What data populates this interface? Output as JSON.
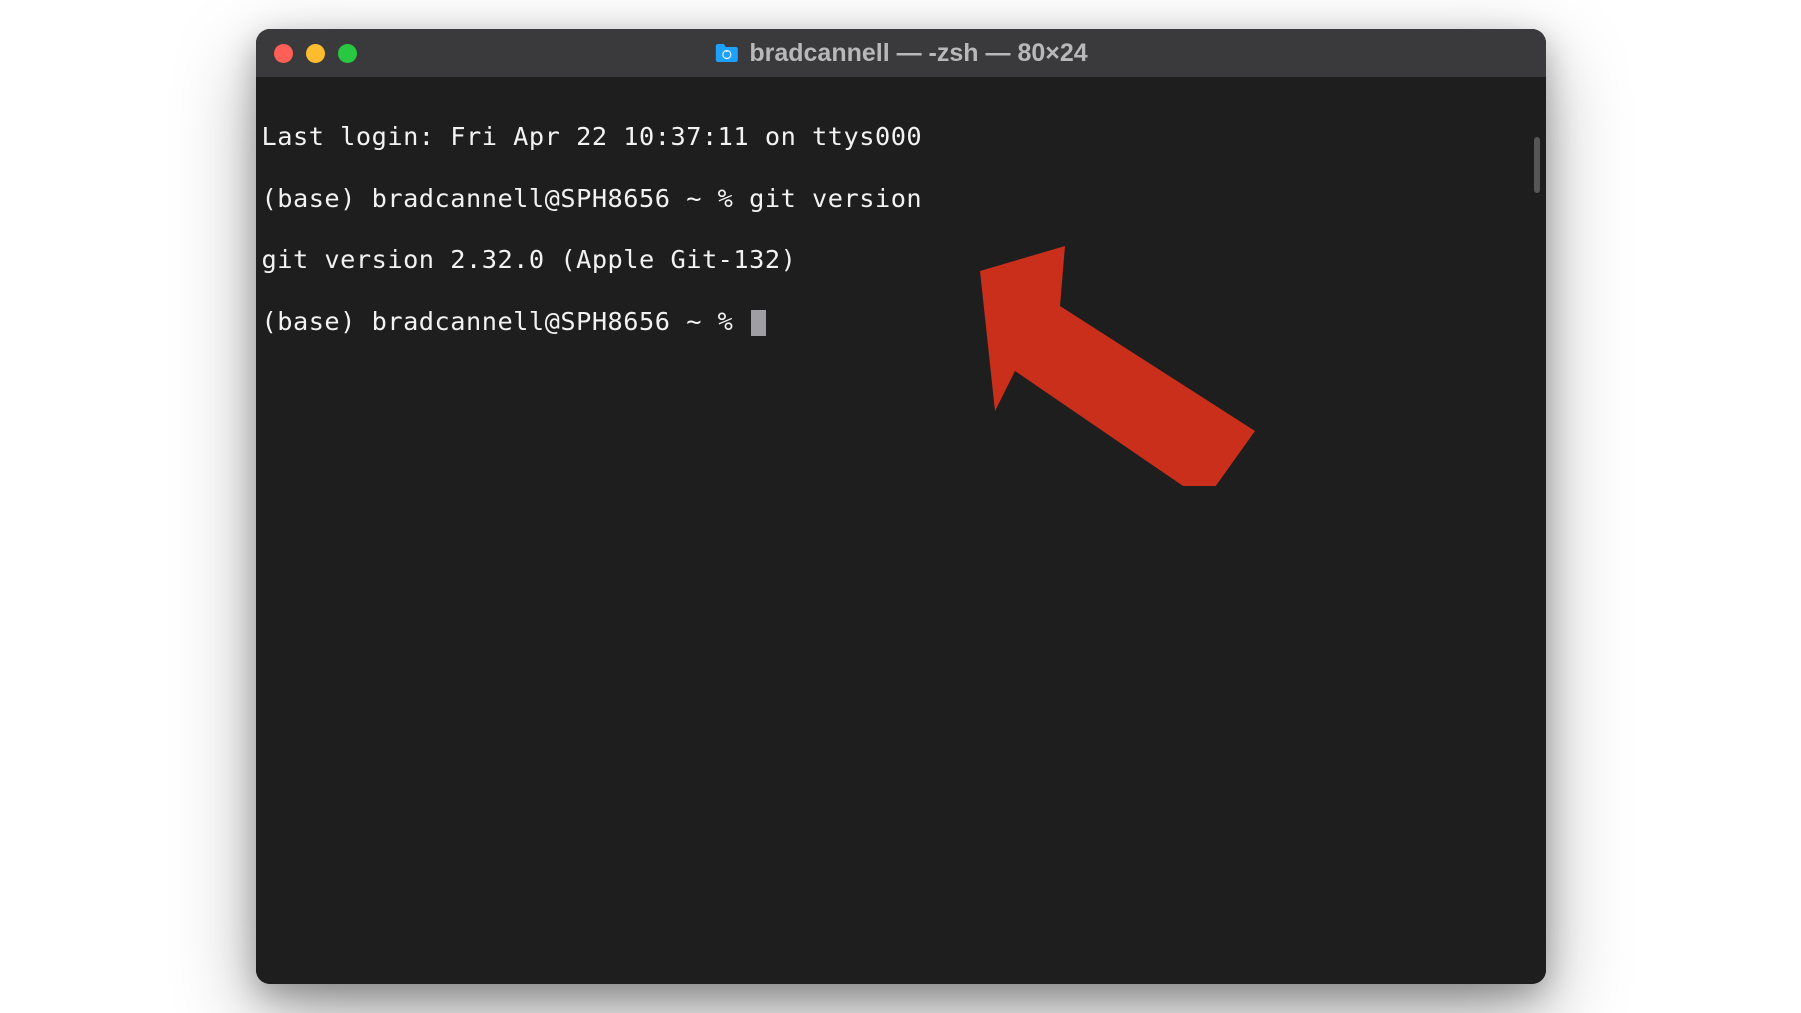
{
  "window": {
    "title": "bradcannell — -zsh — 80×24"
  },
  "terminal": {
    "lines": [
      "Last login: Fri Apr 22 10:37:11 on ttys000",
      "(base) bradcannell@SPH8656 ~ % git version",
      "git version 2.32.0 (Apple Git-132)",
      "(base) bradcannell@SPH8656 ~ % "
    ]
  },
  "annotation": {
    "arrow_color": "#c92f1a"
  }
}
